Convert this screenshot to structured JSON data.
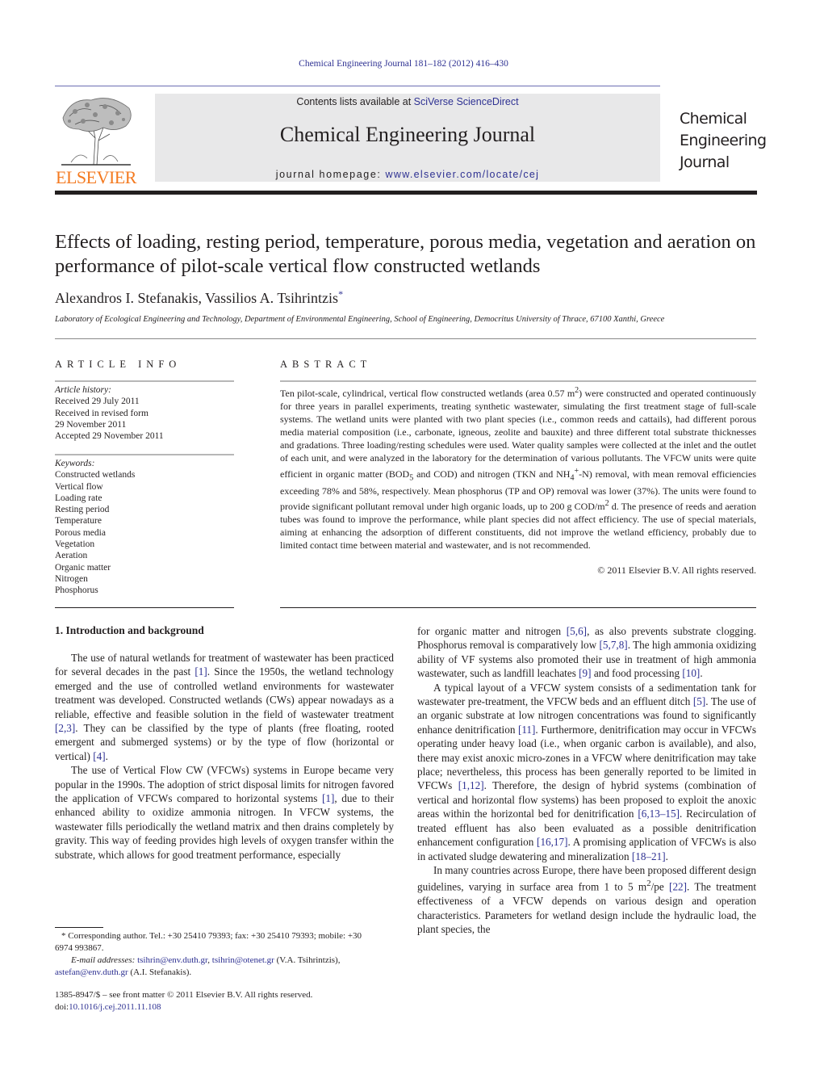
{
  "header": {
    "citation": "Chemical Engineering Journal 181–182 (2012) 416–430",
    "contents_prefix": "Contents lists available at ",
    "contents_link": "SciVerse ScienceDirect",
    "journal_name": "Chemical Engineering Journal",
    "homepage_prefix": "journal homepage: ",
    "homepage_link": "www.elsevier.com/locate/cej",
    "publisher_logo_text": "ELSEVIER",
    "side_title_lines": [
      "Chemical",
      "Engineering",
      "Journal"
    ],
    "colors": {
      "link": "#2e3192",
      "elsevier_orange": "#f47a20",
      "banner_bg": "#e8e8e9"
    }
  },
  "article": {
    "title": "Effects of loading, resting period, temperature, porous media, vegetation and aeration on performance of pilot-scale vertical flow constructed wetlands",
    "authors": "Alexandros I. Stefanakis, Vassilios A. Tsihrintzis",
    "corresponding_mark": "*",
    "affiliation": "Laboratory of Ecological Engineering and Technology, Department of Environmental Engineering, School of Engineering, Democritus University of Thrace, 67100 Xanthi, Greece"
  },
  "article_info": {
    "heading": "ARTICLE INFO",
    "history_label": "Article history:",
    "history": [
      "Received 29 July 2011",
      "Received in revised form",
      "29 November 2011",
      "Accepted 29 November 2011"
    ],
    "keywords_label": "Keywords:",
    "keywords": [
      "Constructed wetlands",
      "Vertical flow",
      "Loading rate",
      "Resting period",
      "Temperature",
      "Porous media",
      "Vegetation",
      "Aeration",
      "Organic matter",
      "Nitrogen",
      "Phosphorus"
    ]
  },
  "abstract": {
    "heading": "ABSTRACT",
    "parts": {
      "p1": "Ten pilot-scale, cylindrical, vertical flow constructed wetlands (area 0.57 m",
      "p2": ") were constructed and operated continuously for three years in parallel experiments, treating synthetic wastewater, simulating the first treatment stage of full-scale systems. The wetland units were planted with two plant species (i.e., common reeds and cattails), had different porous media material composition (i.e., carbonate, igneous, zeolite and bauxite) and three different total substrate thicknesses and gradations. Three loading/resting schedules were used. Water quality samples were collected at the inlet and the outlet of each unit, and were analyzed in the laboratory for the determination of various pollutants. The VFCW units were quite efficient in organic matter (BOD",
      "p3": " and COD) and nitrogen (TKN and NH",
      "p4": "-N) removal, with mean removal efficiencies exceeding 78% and 58%, respectively. Mean phosphorus (TP and OP) removal was lower (37%). The units were found to provide significant pollutant removal under high organic loads, up to 200 g COD/m",
      "p5": " d. The presence of reeds and aeration tubes was found to improve the performance, while plant species did not affect efficiency. The use of special materials, aiming at enhancing the adsorption of different constituents, did not improve the wetland efficiency, probably due to limited contact time between material and wastewater, and is not recommended.",
      "sup2": "2",
      "sub5": "5",
      "sub4": "4",
      "supplus": "+"
    },
    "copyright": "© 2011 Elsevier B.V. All rights reserved."
  },
  "body": {
    "section_heading": "1.  Introduction and background",
    "left": {
      "p1": [
        "The use of natural wetlands for treatment of wastewater has been practiced for several decades in the past ",
        "[1]",
        ". Since the 1950s, the wetland technology emerged and the use of controlled wetland environments for wastewater treatment was developed. Constructed wetlands (CWs) appear nowadays as a reliable, effective and feasible solution in the field of wastewater treatment ",
        "[2,3]",
        ". They can be classified by the type of plants (free floating, rooted emergent and submerged systems) or by the type of flow (horizontal or vertical) ",
        "[4]",
        "."
      ],
      "p2": [
        "The use of Vertical Flow CW (VFCWs) systems in Europe became very popular in the 1990s. The adoption of strict disposal limits for nitrogen favored the application of VFCWs compared to horizontal systems ",
        "[1]",
        ", due to their enhanced ability to oxidize ammonia nitrogen. In VFCW systems, the wastewater fills periodically the wetland matrix and then drains completely by gravity. This way of feeding provides high levels of oxygen transfer within the substrate, which allows for good treatment performance, especially"
      ]
    },
    "right": {
      "p1": [
        "for organic matter and nitrogen ",
        "[5,6]",
        ", as also prevents substrate clogging. Phosphorus removal is comparatively low ",
        "[5,7,8]",
        ". The high ammonia oxidizing ability of VF systems also promoted their use in treatment of high ammonia wastewater, such as landfill leachates ",
        "[9]",
        " and food processing ",
        "[10]",
        "."
      ],
      "p2": [
        "A typical layout of a VFCW system consists of a sedimentation tank for wastewater pre-treatment, the VFCW beds and an effluent ditch ",
        "[5]",
        ". The use of an organic substrate at low nitrogen concentrations was found to significantly enhance denitrification ",
        "[11]",
        ". Furthermore, denitrification may occur in VFCWs operating under heavy load (i.e., when organic carbon is available), and also, there may exist anoxic micro-zones in a VFCW where denitrification may take place; nevertheless, this process has been generally reported to be limited in VFCWs ",
        "[1,12]",
        ". Therefore, the design of hybrid systems (combination of vertical and horizontal flow systems) has been proposed to exploit the anoxic areas within the horizontal bed for denitrification ",
        "[6,13–15]",
        ". Recirculation of treated effluent has also been evaluated as a possible denitrification enhancement configuration ",
        "[16,17]",
        ". A promising application of VFCWs is also in activated sludge dewatering and mineralization ",
        "[18–21]",
        "."
      ],
      "p3": [
        "In many countries across Europe, there have been proposed different design guidelines, varying in surface area from 1 to 5 m",
        "2",
        "/pe ",
        "[22]",
        ". The treatment effectiveness of a VFCW depends on various design and operation characteristics. Parameters for wetland design include the hydraulic load, the plant species, the"
      ]
    }
  },
  "footnotes": {
    "corresponding": "* Corresponding author. Tel.: +30 25410 79393; fax: +30 25410 79393; mobile: +30 6974 993867.",
    "email_label": "E-mail addresses: ",
    "email1": "tsihrin@env.duth.gr",
    "email_sep": ", ",
    "email2": "tsihrin@otenet.gr",
    "email2_owner": " (V.A. Tsihrintzis),",
    "email3": "astefan@env.duth.gr",
    "email3_owner": " (A.I. Stefanakis).",
    "front_matter": "1385-8947/$ – see front matter © 2011 Elsevier B.V. All rights reserved.",
    "doi_label": "doi:",
    "doi": "10.1016/j.cej.2011.11.108"
  }
}
